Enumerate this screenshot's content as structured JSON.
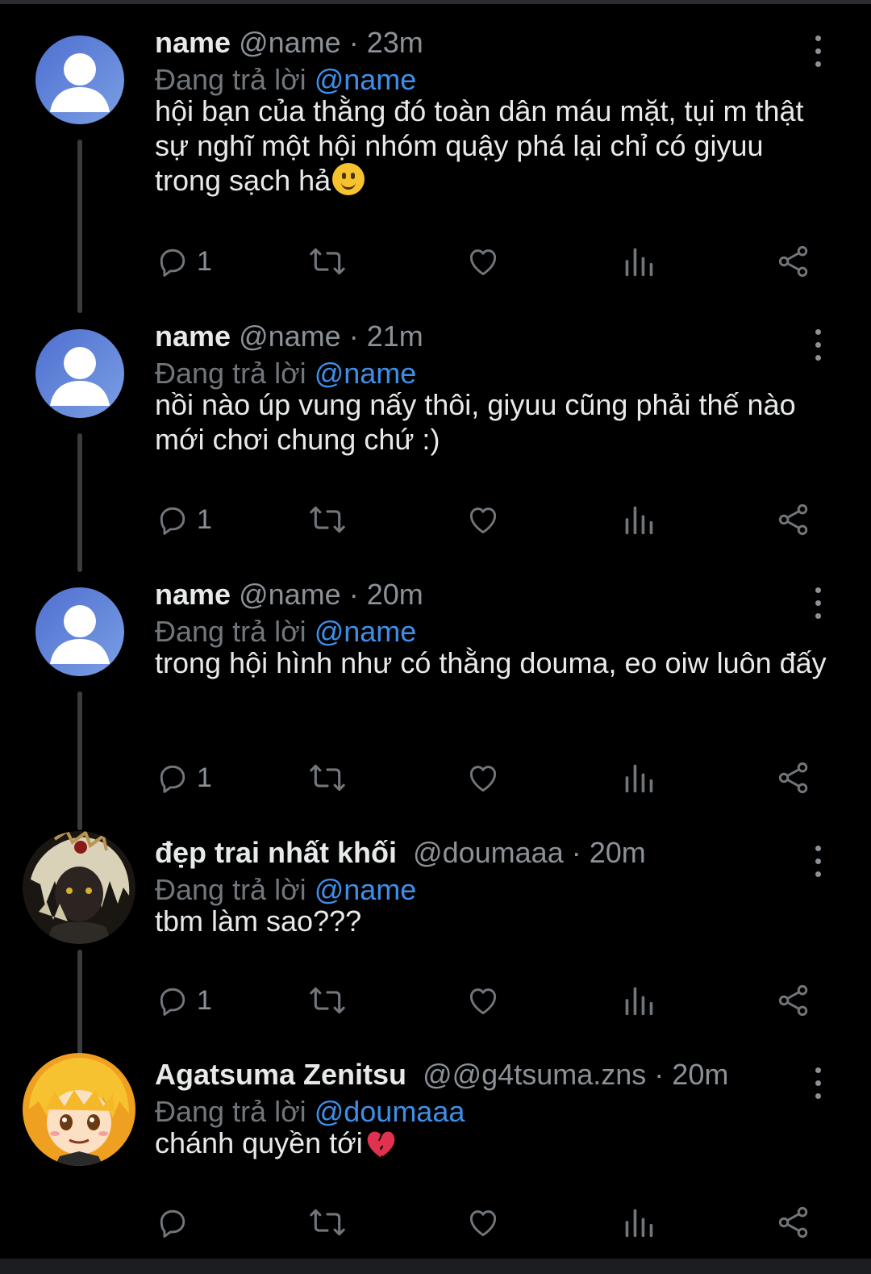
{
  "tweets": [
    {
      "name": "name",
      "handle": "@name",
      "time": "23m",
      "reply_prefix": "Đang trả lời",
      "reply_to": "@name",
      "text": "hội bạn của thằng đó toàn dân máu mặt, tụi m thật sự nghĩ một hội nhóm quậy phá lại chỉ có giyuu trong sạch hả",
      "emoji": "slightly-smiling-face",
      "reply_count": "1"
    },
    {
      "name": "name",
      "handle": "@name",
      "time": "21m",
      "reply_prefix": "Đang trả lời",
      "reply_to": "@name",
      "text": "nồi nào úp vung nấy thôi, giyuu cũng phải thế nào mới chơi chung chứ :)",
      "reply_count": "1"
    },
    {
      "name": "name",
      "handle": "@name",
      "time": "20m",
      "reply_prefix": "Đang trả lời",
      "reply_to": "@name",
      "text": "trong hội hình như có thằng douma, eo oiw luôn đấy",
      "reply_count": "1"
    },
    {
      "name": "đẹp trai nhất khối",
      "handle": "@doumaaa",
      "time": "20m",
      "reply_prefix": "Đang trả lời",
      "reply_to": "@name",
      "text": "tbm làm sao???",
      "reply_count": "1"
    },
    {
      "name": "Agatsuma Zenitsu",
      "handle": "@@g4tsuma.zns",
      "time": "20m",
      "reply_prefix": "Đang trả lời",
      "reply_to": "@doumaaa",
      "text": "chánh quyền tới",
      "emoji": "broken-heart",
      "reply_count": ""
    }
  ],
  "separator": "·",
  "icons": [
    "reply-icon",
    "retweet-icon",
    "like-icon",
    "views-icon",
    "share-icon",
    "more-icon"
  ],
  "colors": {
    "background": "#000000",
    "mention": "#3f8fe8",
    "muted": "#71767b",
    "text": "#e7e9ea"
  }
}
